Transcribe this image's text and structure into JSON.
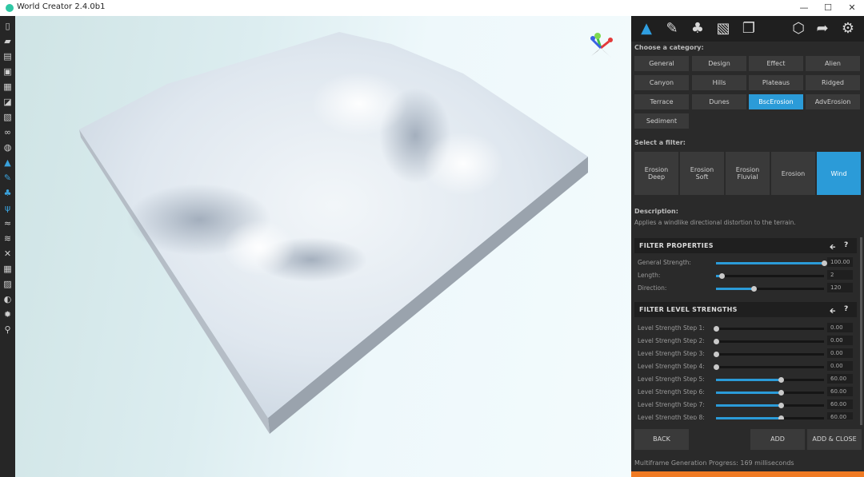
{
  "window": {
    "title": "World Creator 2.4.0b1",
    "minimize": "—",
    "maximize": "☐",
    "close": "✕"
  },
  "panel": {
    "category_label": "Choose a category:",
    "categories": [
      "General",
      "Design",
      "Effect",
      "Alien",
      "Canyon",
      "Hills",
      "Plateaus",
      "Ridged",
      "Terrace",
      "Dunes",
      "BscErosion",
      "AdvErosion",
      "Sediment"
    ],
    "active_category": "BscErosion",
    "filter_label": "Select a filter:",
    "filters": [
      {
        "l1": "Erosion",
        "l2": "Deep"
      },
      {
        "l1": "Erosion",
        "l2": "Soft"
      },
      {
        "l1": "Erosion",
        "l2": "Fluvial"
      },
      {
        "l1": "Erosion",
        "l2": ""
      },
      {
        "l1": "Wind",
        "l2": ""
      }
    ],
    "active_filter": "Wind",
    "description_title": "Description:",
    "description_text": "Applies a windlike directional distortion to the terrain.",
    "filter_properties": {
      "title": "FILTER PROPERTIES",
      "rows": [
        {
          "label": "General Strength:",
          "value": "100.00",
          "level": 1.0
        },
        {
          "label": "Length:",
          "value": "2",
          "level": 0.05
        },
        {
          "label": "Direction:",
          "value": "120",
          "level": 0.35
        }
      ]
    },
    "level_strengths": {
      "title": "FILTER LEVEL STRENGTHS",
      "rows": [
        {
          "label": "Level Strength Step 1:",
          "value": "0.00",
          "level": 0.0
        },
        {
          "label": "Level Strength Step 2:",
          "value": "0.00",
          "level": 0.0
        },
        {
          "label": "Level Strength Step 3:",
          "value": "0.00",
          "level": 0.0
        },
        {
          "label": "Level Strength Step 4:",
          "value": "0.00",
          "level": 0.0
        },
        {
          "label": "Level Strength Step 5:",
          "value": "60.00",
          "level": 0.6
        },
        {
          "label": "Level Strength Step 6:",
          "value": "60.00",
          "level": 0.6
        },
        {
          "label": "Level Strength Step 7:",
          "value": "60.00",
          "level": 0.6
        },
        {
          "label": "Level Strength Step 8:",
          "value": "60.00",
          "level": 0.6
        }
      ]
    },
    "reset_icon": "🡨",
    "help_icon": "?",
    "back_label": "BACK",
    "add_label": "ADD",
    "add_close_label": "ADD & CLOSE",
    "status": "Multiframe Generation Progress: 169 milliseconds"
  },
  "colors": {
    "accent": "#2b9bd8",
    "progress": "#f07a22",
    "panel_bg": "#2a2a2a"
  }
}
